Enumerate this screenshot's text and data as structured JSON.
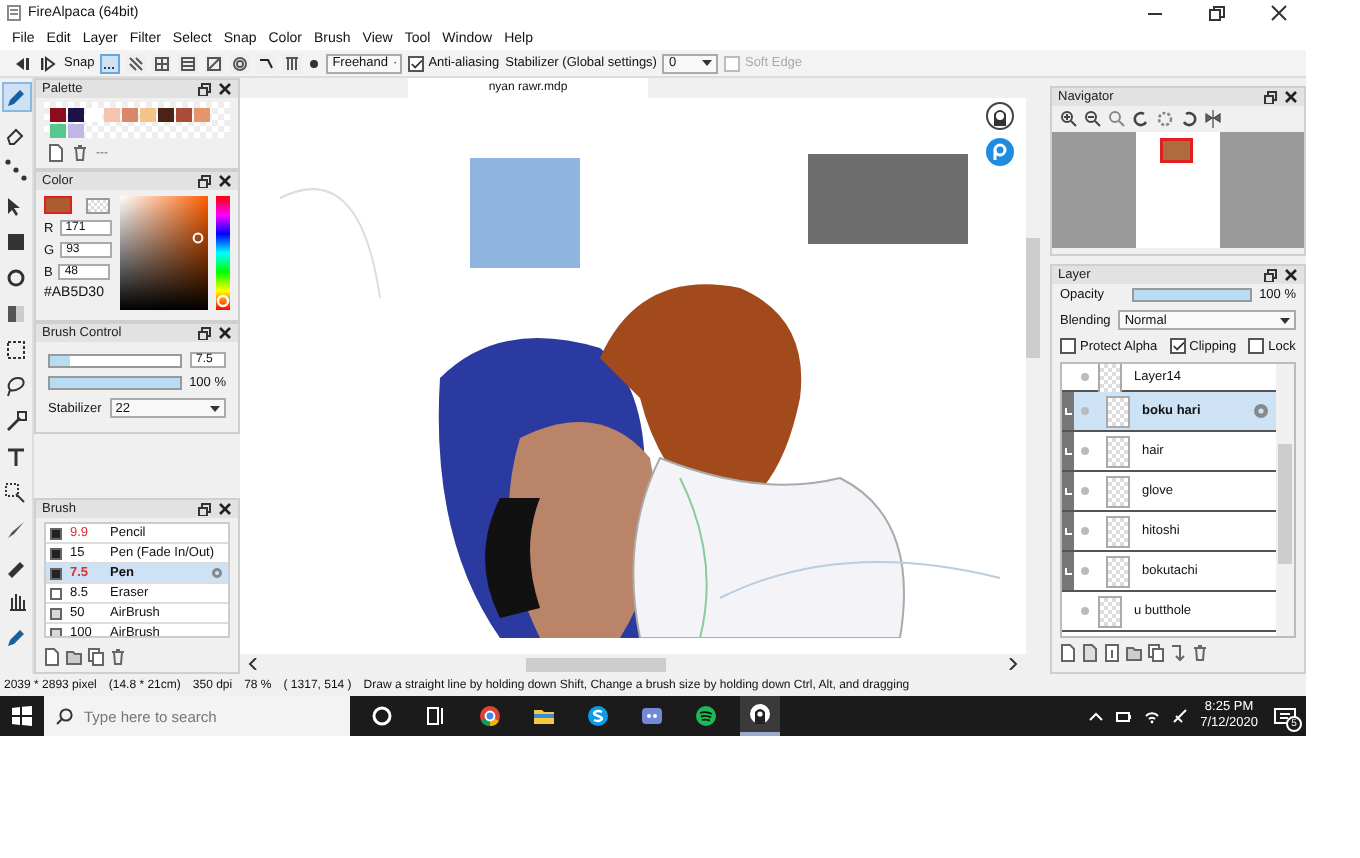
{
  "window": {
    "title": "FireAlpaca (64bit)"
  },
  "menu": [
    "File",
    "Edit",
    "Layer",
    "Filter",
    "Select",
    "Snap",
    "Color",
    "Brush",
    "View",
    "Tool",
    "Window",
    "Help"
  ],
  "toolbar": {
    "snap_label": "Snap",
    "snap_modes": [
      {
        "selected": true
      },
      {
        "selected": false
      },
      {
        "selected": false
      },
      {
        "selected": false
      },
      {
        "selected": false
      },
      {
        "selected": false
      },
      {
        "selected": false
      },
      {
        "selected": false
      }
    ],
    "draw_mode": "Freehand",
    "anti_aliasing": {
      "label": "Anti-aliasing",
      "checked": true
    },
    "stabilizer_label": "Stabilizer (Global settings)",
    "stabilizer_value": "0",
    "soft_edge": {
      "label": "Soft Edge",
      "checked": false,
      "disabled": true
    }
  },
  "tools": [
    {
      "selected": true
    },
    {
      "selected": false
    },
    {
      "selected": false
    },
    {
      "selected": false
    },
    {
      "selected": false
    },
    {
      "selected": false
    },
    {
      "selected": false
    },
    {
      "selected": false
    },
    {
      "selected": false
    },
    {
      "selected": false
    },
    {
      "selected": false
    },
    {
      "selected": false
    },
    {
      "selected": false
    },
    {
      "selected": false
    },
    {
      "selected": false
    },
    {
      "selected": false
    }
  ],
  "palette": {
    "title": "Palette",
    "colors": [
      {
        "color": "#8b0e1a"
      },
      {
        "color": "#1c1248"
      },
      {
        "color": "#ffffff"
      },
      {
        "color": "#f3c4b0"
      },
      {
        "color": "#d9876a"
      },
      {
        "color": "#f5c487"
      },
      {
        "color": "#4a2216"
      },
      {
        "color": "#a84e38"
      },
      {
        "color": "#e8946a"
      },
      {
        "color": "#56c78f"
      },
      {
        "color": "#c2b6e8"
      }
    ],
    "separator": "---"
  },
  "color": {
    "title": "Color",
    "channels": [
      {
        "label": "R",
        "value": "171"
      },
      {
        "label": "G",
        "value": "93"
      },
      {
        "label": "B",
        "value": "48"
      }
    ],
    "hex": "#AB5D30",
    "hue": {
      "level": 0.02
    }
  },
  "brush_control": {
    "title": "Brush Control",
    "size": {
      "value": "7.5",
      "level": 0.15
    },
    "opacity": {
      "value": "100 %",
      "level": 1
    },
    "stabilizer_label": "Stabilizer",
    "stabilizer": "22"
  },
  "brush": {
    "title": "Brush",
    "items": [
      {
        "size": "9.9",
        "name": "Pencil",
        "color": "#222222",
        "modified": true,
        "selected": false
      },
      {
        "size": "15",
        "name": "Pen (Fade In/Out)",
        "color": "#222222",
        "modified": false,
        "selected": false
      },
      {
        "size": "7.5",
        "name": "Pen",
        "color": "#222222",
        "modified": true,
        "selected": true
      },
      {
        "size": "8.5",
        "name": "Eraser",
        "color": "#ffffff",
        "modified": false,
        "selected": false
      },
      {
        "size": "50",
        "name": "AirBrush",
        "color": "#d8d8d8",
        "modified": false,
        "selected": false
      },
      {
        "size": "100",
        "name": "AirBrush",
        "color": "#d8d8d8",
        "modified": false,
        "selected": false
      }
    ]
  },
  "canvas": {
    "tab": "nyan rawr.mdp"
  },
  "navigator": {
    "title": "Navigator"
  },
  "layer": {
    "title": "Layer",
    "opacity": {
      "label": "Opacity",
      "value": "100 %",
      "level": 1
    },
    "blending_label": "Blending",
    "blending": "Normal",
    "options": [
      {
        "label": "Protect Alpha",
        "checked": false
      },
      {
        "label": "Clipping",
        "checked": true
      },
      {
        "label": "Lock",
        "checked": false
      }
    ],
    "layers": [
      {
        "name": "Layer14",
        "clipped": false,
        "selected": false
      },
      {
        "name": "boku hari",
        "clipped": true,
        "selected": true
      },
      {
        "name": "hair",
        "clipped": true,
        "selected": false
      },
      {
        "name": "glove",
        "clipped": true,
        "selected": false
      },
      {
        "name": "hitoshi",
        "clipped": true,
        "selected": false
      },
      {
        "name": "bokutachi",
        "clipped": true,
        "selected": false
      },
      {
        "name": "u butthole",
        "clipped": false,
        "selected": false
      }
    ]
  },
  "status_bar": [
    "2039 * 2893 pixel",
    "(14.8 * 21cm)",
    "350 dpi",
    "78 %",
    "( 1317, 514 )",
    "Draw a straight line by holding down Shift, Change a brush size by holding down Ctrl, Alt, and dragging"
  ],
  "taskbar": {
    "search_placeholder": "Type here to search",
    "time": "8:25 PM",
    "date": "7/12/2020",
    "notifications": "5"
  }
}
